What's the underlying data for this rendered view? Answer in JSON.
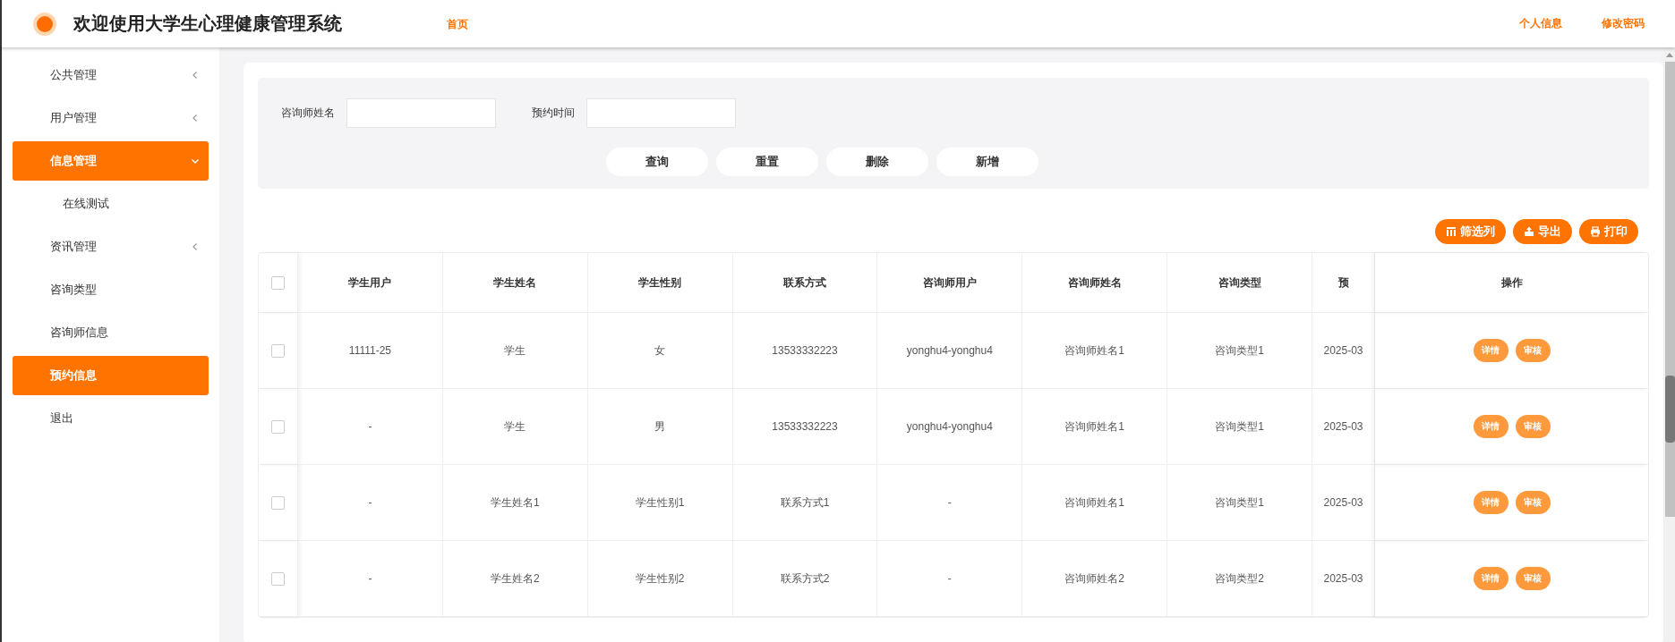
{
  "header": {
    "title": "欢迎使用大学生心理健康管理系统",
    "nav": [
      "首页"
    ],
    "links": [
      "个人信息",
      "修改密码"
    ]
  },
  "sidebar": {
    "items": [
      {
        "kind": "group",
        "label": "公共管理",
        "expanded": false
      },
      {
        "kind": "group",
        "label": "用户管理",
        "expanded": false
      },
      {
        "kind": "group",
        "label": "信息管理",
        "expanded": true,
        "children": [
          {
            "kind": "link",
            "label": "在线测试",
            "selected": false
          }
        ]
      },
      {
        "kind": "group",
        "label": "资讯管理",
        "expanded": false
      },
      {
        "kind": "link",
        "label": "咨询类型",
        "selected": false
      },
      {
        "kind": "link",
        "label": "咨询师信息",
        "selected": false
      },
      {
        "kind": "link",
        "label": "预约信息",
        "selected": true
      },
      {
        "kind": "link",
        "label": "退出",
        "selected": false
      }
    ]
  },
  "search": {
    "fields": [
      {
        "label": "咨询师姓名"
      },
      {
        "label": "预约时间"
      }
    ],
    "buttons": [
      "查询",
      "重置",
      "删除",
      "新增"
    ]
  },
  "toolbar": [
    {
      "kind": "columns",
      "label": "筛选列"
    },
    {
      "kind": "export",
      "label": "导出"
    },
    {
      "kind": "print",
      "label": "打印"
    }
  ],
  "table": {
    "select_all": {
      "checked": false
    },
    "columns": [
      "学生用户",
      "学生姓名",
      "学生性别",
      "联系方式",
      "咨询师用户",
      "咨询师姓名",
      "咨询类型",
      "预",
      "操作"
    ],
    "rows": [
      {
        "checked": false,
        "cells": [
          "11111-25",
          "学生",
          "女",
          "13533332223",
          "yonghu4-yonghu4",
          "咨询师姓名1",
          "咨询类型1",
          "2025-03"
        ],
        "actions": [
          "详情",
          "审核"
        ]
      },
      {
        "checked": false,
        "cells": [
          "-",
          "学生",
          "男",
          "13533332223",
          "yonghu4-yonghu4",
          "咨询师姓名1",
          "咨询类型1",
          "2025-03"
        ],
        "actions": [
          "详情",
          "审核"
        ]
      },
      {
        "checked": false,
        "cells": [
          "-",
          "学生姓名1",
          "学生性别1",
          "联系方式1",
          "-",
          "咨询师姓名1",
          "咨询类型1",
          "2025-03"
        ],
        "actions": [
          "详情",
          "审核"
        ]
      },
      {
        "checked": false,
        "cells": [
          "-",
          "学生姓名2",
          "学生性别2",
          "联系方式2",
          "-",
          "咨询师姓名2",
          "咨询类型2",
          "2025-03"
        ],
        "actions": [
          "详情",
          "审核"
        ]
      }
    ]
  }
}
